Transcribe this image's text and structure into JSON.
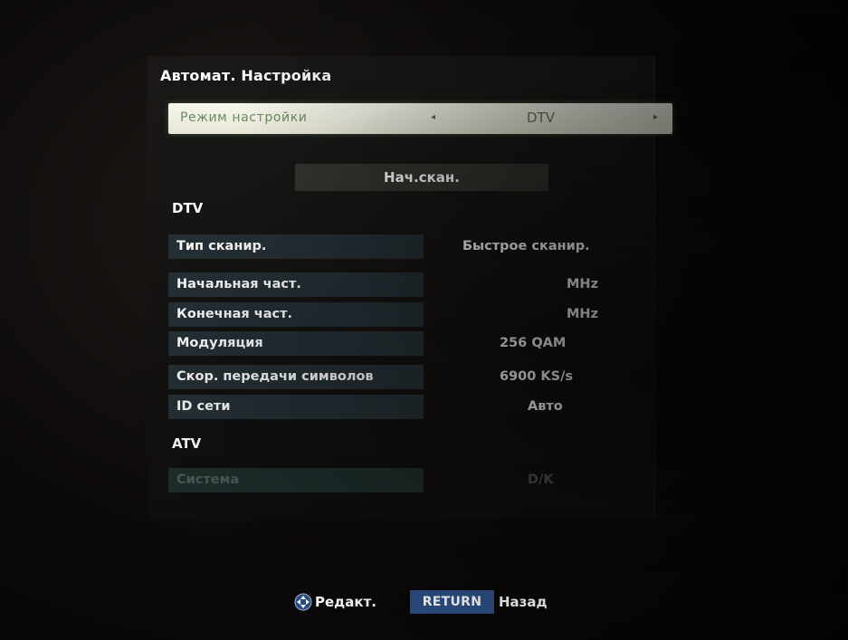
{
  "menu": {
    "title": "Автомат. Настройка",
    "mode_label": "Режим настройки",
    "mode_value": "DTV",
    "mode_left_arrow": "◂",
    "mode_right_arrow": "▸",
    "scan_button": "Нач.скан."
  },
  "dtv": {
    "header": "DTV",
    "rows": [
      {
        "label": "Тип сканир.",
        "value": "Быстрое сканир."
      },
      {
        "label": "Начальная част.",
        "value": "MHz"
      },
      {
        "label": "Конечная част.",
        "value": "MHz"
      },
      {
        "label": "Модуляция",
        "value": "256 QAM"
      },
      {
        "label": "Скор. передачи символов",
        "value": "6900 KS/s"
      },
      {
        "label": "ID сети",
        "value": "Авто"
      }
    ]
  },
  "atv": {
    "header": "ATV",
    "rows": [
      {
        "label": "Система",
        "value": "D/K",
        "disabled": true
      }
    ]
  },
  "footer": {
    "nav_icon": "navigation-dpad-icon",
    "edit_label": "Редакт.",
    "return_key": "RETURN",
    "back_label": "Назад"
  },
  "colors": {
    "highlight_row": "#f2f2e6",
    "highlight_text": "#6c8a60",
    "param_label_bg": "#253036",
    "return_key_bg": "#2d4f86"
  }
}
